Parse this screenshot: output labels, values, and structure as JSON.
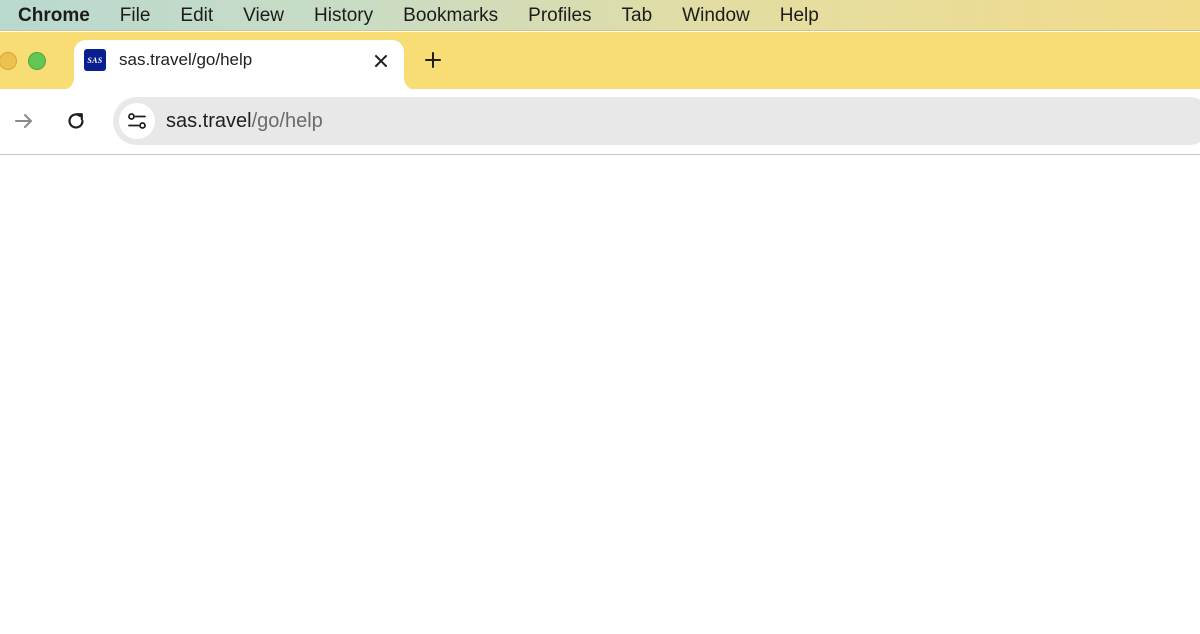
{
  "menubar": {
    "app": "Chrome",
    "items": [
      "File",
      "Edit",
      "View",
      "History",
      "Bookmarks",
      "Profiles",
      "Tab",
      "Window",
      "Help"
    ]
  },
  "tab": {
    "title": "sas.travel/go/help",
    "favicon_text": "SAS",
    "favicon_color": "#0a1f8f",
    "close_icon": "close-icon"
  },
  "newtab": {
    "icon": "plus-icon"
  },
  "toolbar": {
    "forward_icon": "arrow-right-icon",
    "reload_icon": "reload-icon",
    "site_info_icon": "tune-icon"
  },
  "omnibox": {
    "host": "sas.travel",
    "path": "/go/help"
  },
  "colors": {
    "tabstrip": "#f8dc74",
    "omnibox_bg": "#e8e8e8"
  }
}
